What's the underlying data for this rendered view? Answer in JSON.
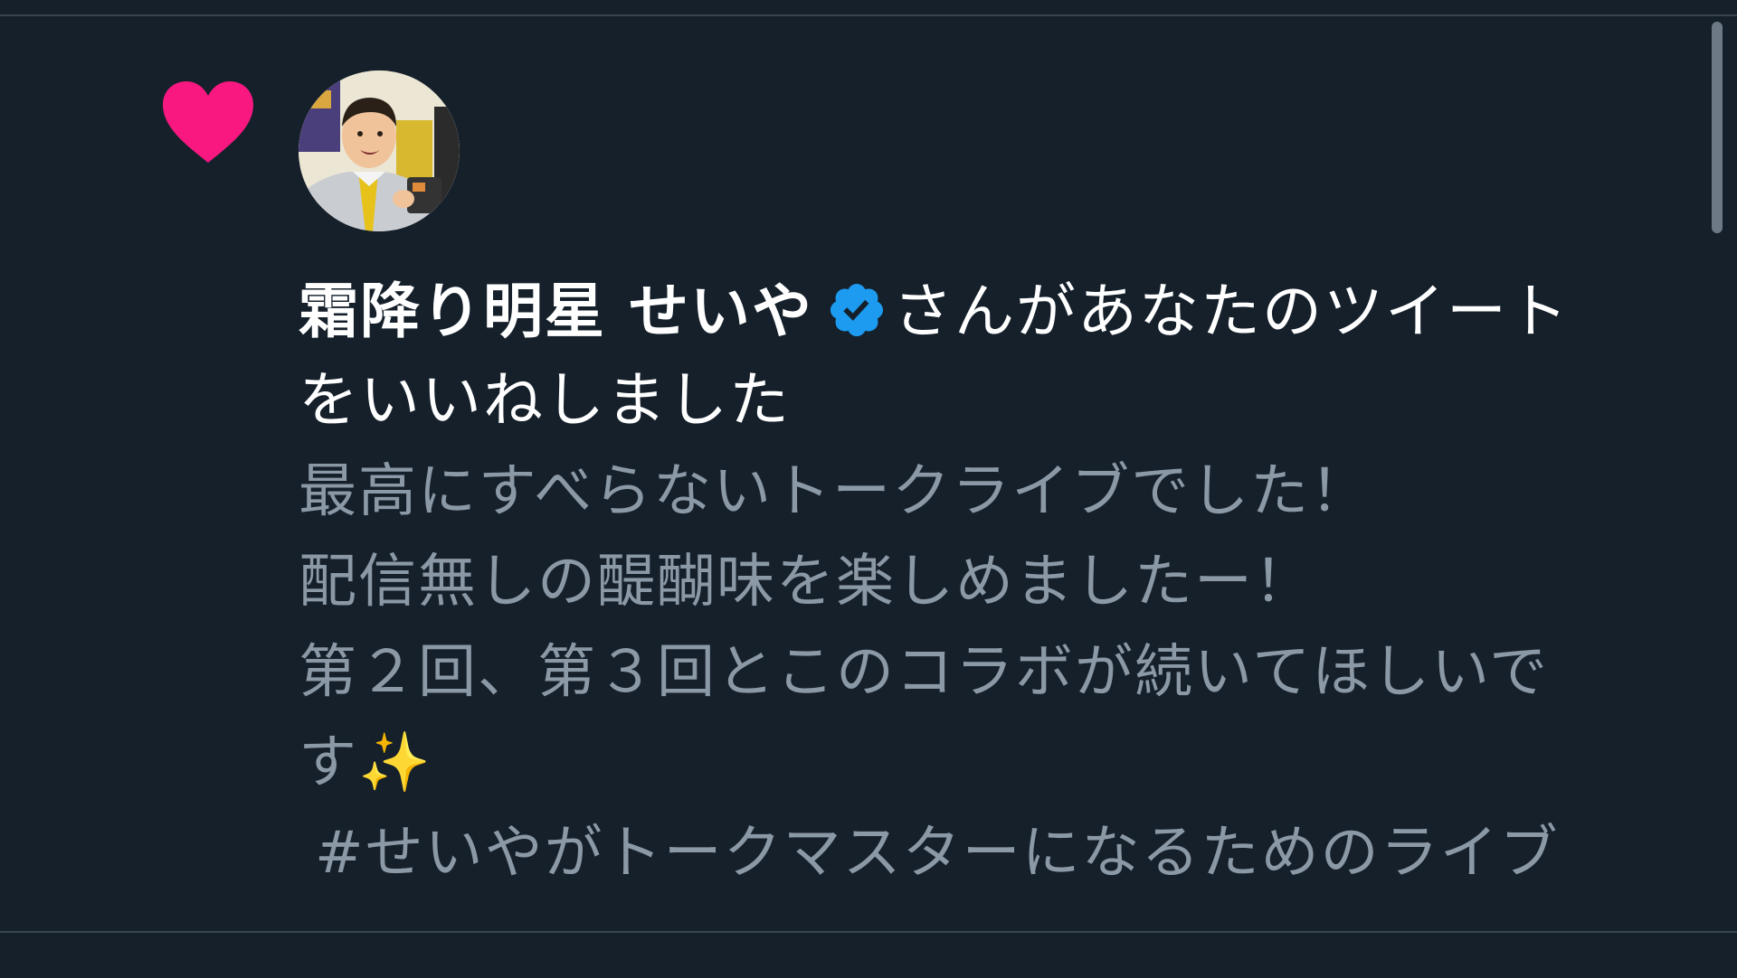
{
  "notification": {
    "type_icon": "heart-icon",
    "actor_name": "霜降り明星 せいや",
    "verified_icon": "verified-badge-icon",
    "action_line1": "さんがあなたのツイート",
    "action_line2": "をいいねしました"
  },
  "tweet": {
    "line1": "最高にすべらないトークライブでした！",
    "line2": "配信無しの醍醐味を楽しめましたー！",
    "line3": "第２回、第３回とこのコラボが続いてほしいで",
    "line4": "す✨",
    "hashtag": "#せいやがトークマスターになるためのライブ"
  },
  "colors": {
    "background": "#15202b",
    "heart": "#f91880",
    "verified": "#1d9bf0",
    "primary_text": "#ffffff",
    "secondary_text": "#8b98a5",
    "divider": "#38444d"
  }
}
